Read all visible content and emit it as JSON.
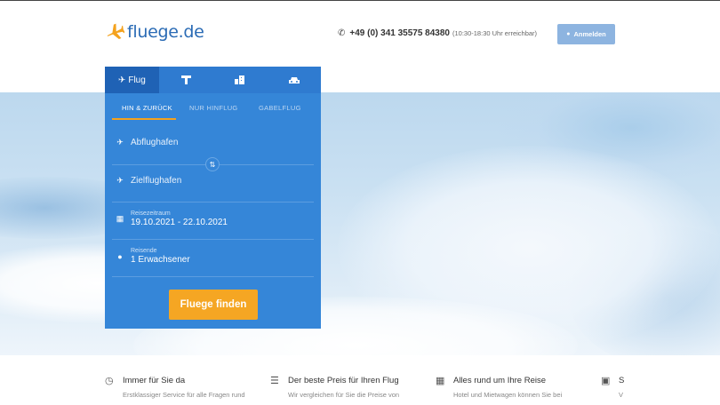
{
  "header": {
    "logo_text": "fluege.de",
    "phone_number": "+49 (0) 341 35575 84380",
    "phone_hours": "(10:30-18:30 Uhr erreichbar)",
    "login_label": "Anmelden"
  },
  "search": {
    "tabs": [
      {
        "label": "Flug",
        "icon": "plane-icon"
      },
      {
        "label": "",
        "icon": "hotel-icon"
      },
      {
        "label": "",
        "icon": "building-icon"
      },
      {
        "label": "",
        "icon": "car-icon"
      }
    ],
    "trip_types": [
      "HIN & ZURÜCK",
      "NUR HINFLUG",
      "GABELFLUG"
    ],
    "departure_placeholder": "Abflughafen",
    "destination_placeholder": "Zielflughafen",
    "date_label": "Reisezeitraum",
    "date_value": "19.10.2021 - 22.10.2021",
    "travellers_label": "Reisende",
    "travellers_value": "1 Erwachsener",
    "submit_label": "Fluege finden"
  },
  "features": [
    {
      "title": "Immer für Sie da",
      "desc": "Erstklassiger Service für alle Fragen rund",
      "icon": "clock-icon"
    },
    {
      "title": "Der beste Preis für Ihren Flug",
      "desc": "Wir vergleichen für Sie die Preise von",
      "icon": "sliders-icon"
    },
    {
      "title": "Alles rund um Ihre Reise",
      "desc": "Hotel und Mietwagen können Sie bei",
      "icon": "city-icon"
    },
    {
      "title": "S",
      "desc": "V",
      "icon": "card-icon"
    }
  ],
  "colors": {
    "panel": "#3586d8",
    "panel_active_tab": "#1f62b5",
    "accent": "#f5a623",
    "logo": "#2a6bb5"
  }
}
